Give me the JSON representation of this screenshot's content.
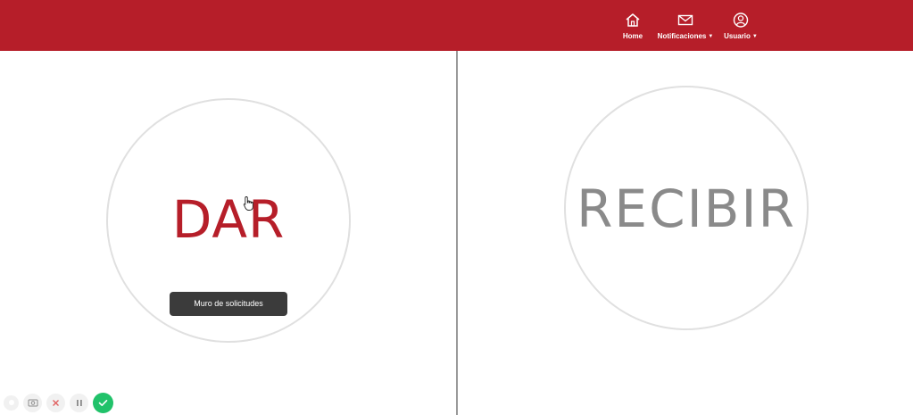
{
  "nav": {
    "home": {
      "label": "Home",
      "icon": "home-icon"
    },
    "notifications": {
      "label": "Notificaciones",
      "icon": "envelope-icon"
    },
    "user": {
      "label": "Usuario",
      "icon": "user-icon"
    }
  },
  "options": {
    "give": {
      "label": "DAR",
      "tooltip": "Muro de solicitudes"
    },
    "receive": {
      "label": "RECIBIR"
    }
  },
  "recorder": {
    "buttons": [
      "record-dot-icon",
      "camera-icon",
      "close-icon",
      "pause-icon",
      "check-icon"
    ]
  },
  "colors": {
    "brand_red": "#b61e29",
    "recibir_gray": "#8a8a8a",
    "confirm_green": "#21c26a"
  }
}
